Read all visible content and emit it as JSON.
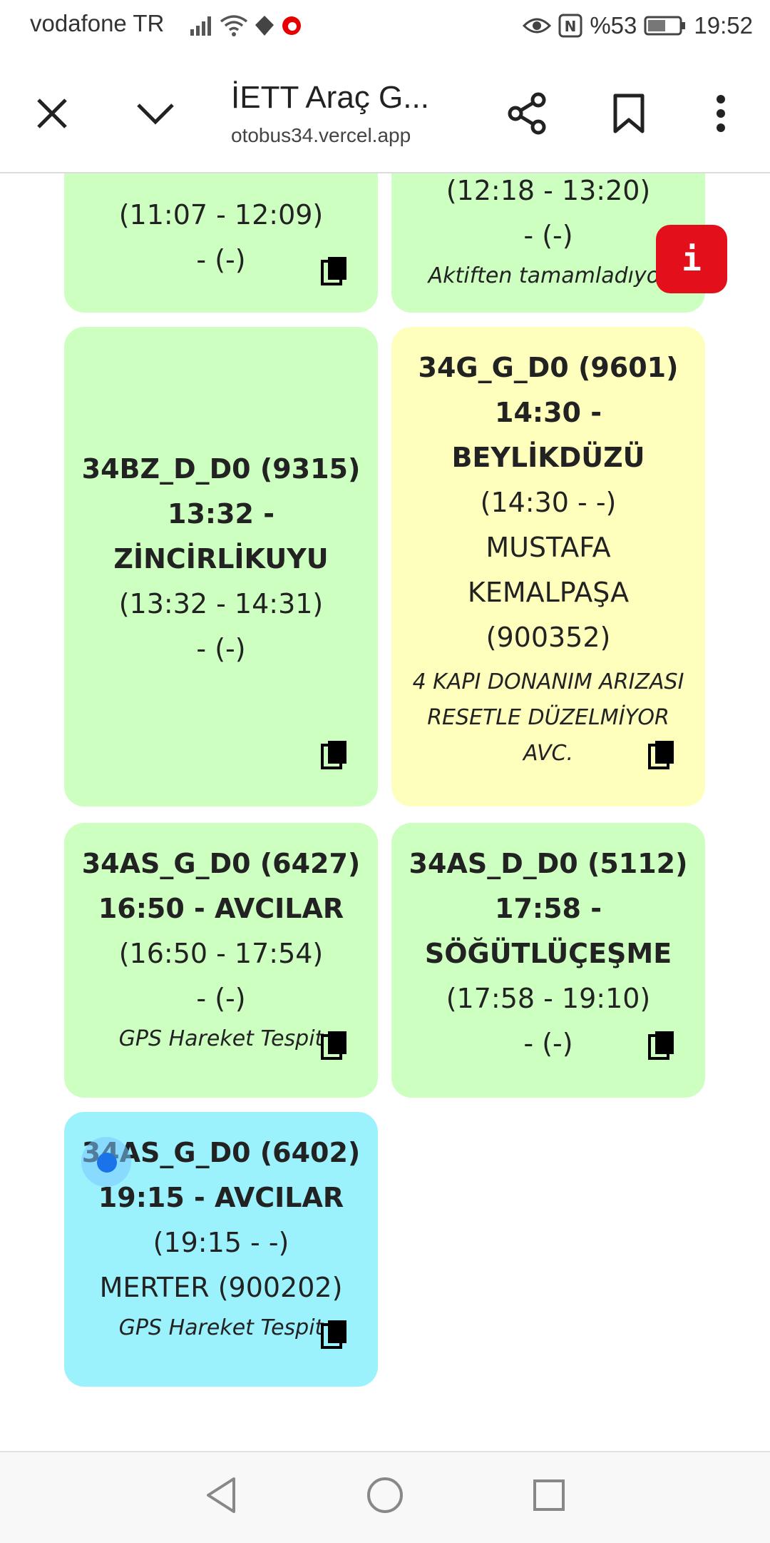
{
  "status_bar": {
    "carrier": "vodafone TR",
    "battery_percent": "%53",
    "time": "19:52"
  },
  "toolbar": {
    "title": "İETT Araç G...",
    "url": "otobus34.vercel.app"
  },
  "info_badge": {
    "label": "i"
  },
  "cards": [
    {
      "color": "#ccffc0",
      "lines": [
        "(11:07 - 12:09)",
        "- (-)"
      ],
      "note": ""
    },
    {
      "color": "#ccffc0",
      "lines": [
        "(12:18 - 13:20)",
        "- (-)"
      ],
      "note": "Aktiften tamamladıyor"
    },
    {
      "color": "#ccffc0",
      "title": [
        "34BZ_D_D0 (9315)",
        "13:32 -",
        "ZİNCİRLİKUYU"
      ],
      "lines": [
        "(13:32 - 14:31)",
        "- (-)"
      ],
      "note": ""
    },
    {
      "color": "#ffffbd",
      "title": [
        "34G_G_D0 (9601)",
        "14:30 -",
        "BEYLİKDÜZÜ"
      ],
      "lines": [
        "(14:30 - -)",
        "MUSTAFA",
        "KEMALPAŞA",
        "(900352)"
      ],
      "note": "4 KAPI DONANIM ARIZASI RESETLE DÜZELMİYOR AVC."
    },
    {
      "color": "#ccffc0",
      "title": [
        "34AS_G_D0 (6427)",
        "16:50 - AVCILAR"
      ],
      "lines": [
        "(16:50 - 17:54)",
        "- (-)"
      ],
      "note": "GPS Hareket Tespit"
    },
    {
      "color": "#ccffc0",
      "title": [
        "34AS_D_D0 (5112)",
        "17:58 -",
        "SÖĞÜTLÜÇEŞME"
      ],
      "lines": [
        "(17:58 - 19:10)",
        "- (-)"
      ],
      "note": ""
    },
    {
      "color": "#9cf2fc",
      "title": [
        "34AS_G_D0 (6402)",
        "19:15 - AVCILAR"
      ],
      "lines": [
        "(19:15 - -)",
        "MERTER (900202)"
      ],
      "note": "GPS Hareket Tespit"
    }
  ],
  "icons": {
    "close": "close-icon",
    "collapse": "chevron-down-icon",
    "share": "share-icon",
    "bookmark": "bookmark-icon",
    "more": "more-vertical-icon",
    "copy": "copy-icon",
    "back": "back-triangle-icon",
    "home": "home-circle-icon",
    "recents": "recents-square-icon"
  }
}
